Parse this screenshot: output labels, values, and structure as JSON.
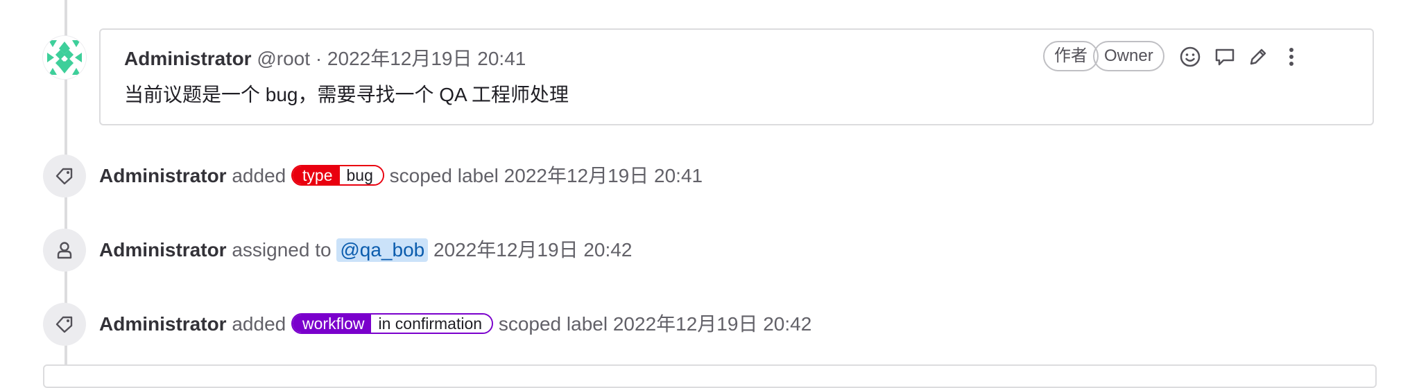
{
  "comment": {
    "author_name": "Administrator",
    "author_handle": "@root",
    "separator": "·",
    "timestamp": "2022年12月19日 20:41",
    "body": "当前议题是一个 bug，需要寻找一个 QA 工程师处理",
    "badges": {
      "author": "作者",
      "role": "Owner"
    },
    "actions": [
      "smile-icon",
      "comment-icon",
      "pencil-icon",
      "more-vertical-icon"
    ]
  },
  "events": [
    {
      "actor": "Administrator",
      "verb": "added",
      "label": {
        "key": "type",
        "value": "bug",
        "color": "#e9000f"
      },
      "suffix": "scoped label",
      "timestamp": "2022年12月19日 20:41",
      "icon": "label-icon"
    },
    {
      "actor": "Administrator",
      "verb": "assigned to",
      "mention": "@qa_bob",
      "timestamp": "2022年12月19日 20:42",
      "icon": "user-icon"
    },
    {
      "actor": "Administrator",
      "verb": "added",
      "label": {
        "key": "workflow",
        "value": "in confirmation",
        "color": "#7a00cc"
      },
      "suffix": "scoped label",
      "timestamp": "2022年12月19日 20:42",
      "icon": "label-icon"
    }
  ]
}
